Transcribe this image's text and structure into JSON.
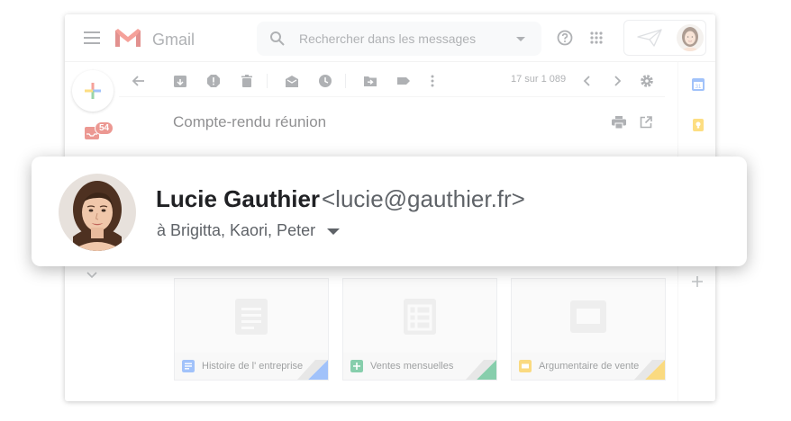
{
  "app": {
    "name": "Gmail"
  },
  "search": {
    "placeholder": "Rechercher dans les messages"
  },
  "nav": {
    "inbox_badge": "54"
  },
  "toolbar": {
    "count": "17 sur 1 089"
  },
  "message": {
    "subject": "Compte-rendu réunion"
  },
  "sender": {
    "name": "Lucie Gauthier",
    "email": "<lucie@gauthier.fr>",
    "recipients": "à Brigitta, Kaori, Peter"
  },
  "attachments": [
    {
      "name": "Histoire de l' entreprise",
      "kind": "docs",
      "color": "#4285f4"
    },
    {
      "name": "Ventes mensuelles",
      "kind": "sheets",
      "color": "#0f9d58"
    },
    {
      "name": "Argumentaire de vente",
      "kind": "slides",
      "color": "#f4b400"
    }
  ],
  "colors": {
    "gmail_red": "#ea4335",
    "badge_red": "#d93025",
    "icon_grey": "#5f6368"
  }
}
